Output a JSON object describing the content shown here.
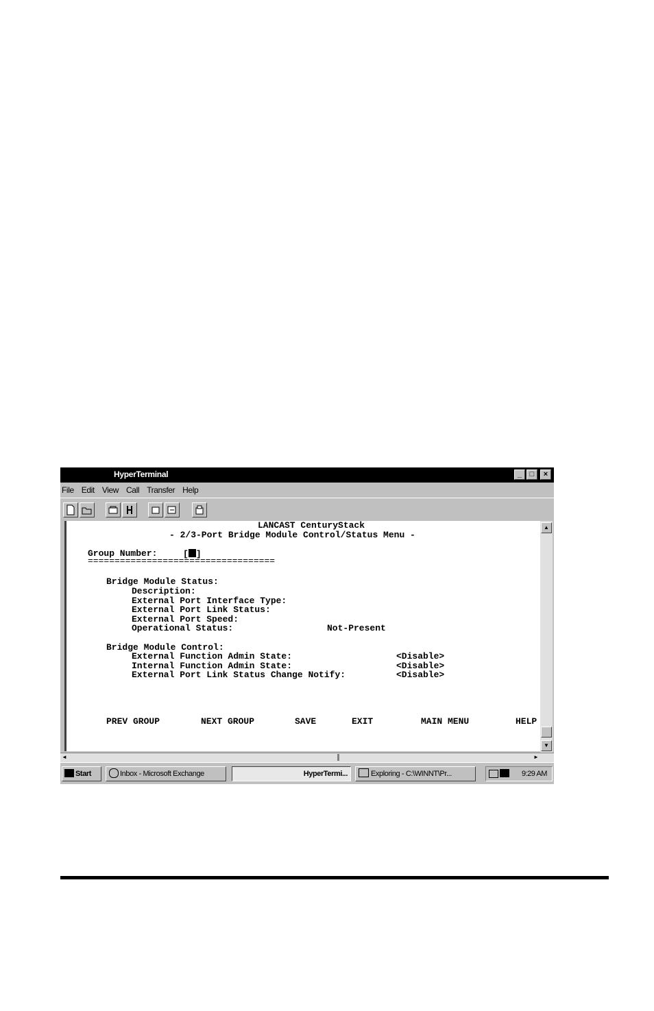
{
  "window": {
    "title": "HyperTerminal",
    "controls": {
      "minimize": "_",
      "maximize": "□",
      "close": "×"
    }
  },
  "menu": [
    "File",
    "Edit",
    "View",
    "Call",
    "Transfer",
    "Help"
  ],
  "toolbar": {
    "buttons": [
      "new-icon",
      "open-icon",
      "connect-icon",
      "disconnect-icon",
      "send-icon",
      "receive-icon",
      "properties-icon"
    ]
  },
  "terminal": {
    "title": "LANCAST CenturyStack",
    "subtitle": "- 2/3-Port Bridge Module Control/Status Menu -",
    "group_label": "Group Number:",
    "group_open": "[",
    "group_close": "]",
    "separator": "===================================",
    "status_header": "Bridge Module Status:",
    "status_fields": {
      "description": "Description:",
      "interface_type": "External Port Interface Type:",
      "link_status": "External Port Link Status:",
      "speed": "External Port Speed:",
      "operational": "Operational Status:",
      "operational_value": "Not-Present"
    },
    "control_header": "Bridge Module Control:",
    "control_fields": {
      "ext_admin": "External Function Admin State:",
      "ext_admin_value": "<Disable>",
      "int_admin": "Internal Function Admin State:",
      "int_admin_value": "<Disable>",
      "link_notify": "External Port Link Status Change Notify:",
      "link_notify_value": "<Disable>"
    },
    "commands": {
      "prev": "PREV GROUP",
      "next": "NEXT GROUP",
      "save": "SAVE",
      "exit": "EXIT",
      "main": "MAIN MENU",
      "help": "HELP"
    }
  },
  "taskbar": {
    "start": "Start",
    "tasks": [
      "Inbox - Microsoft Exchange",
      "HyperTermi...",
      "Exploring - C:\\WINNT\\Pr..."
    ],
    "clock": "9:29 AM"
  }
}
